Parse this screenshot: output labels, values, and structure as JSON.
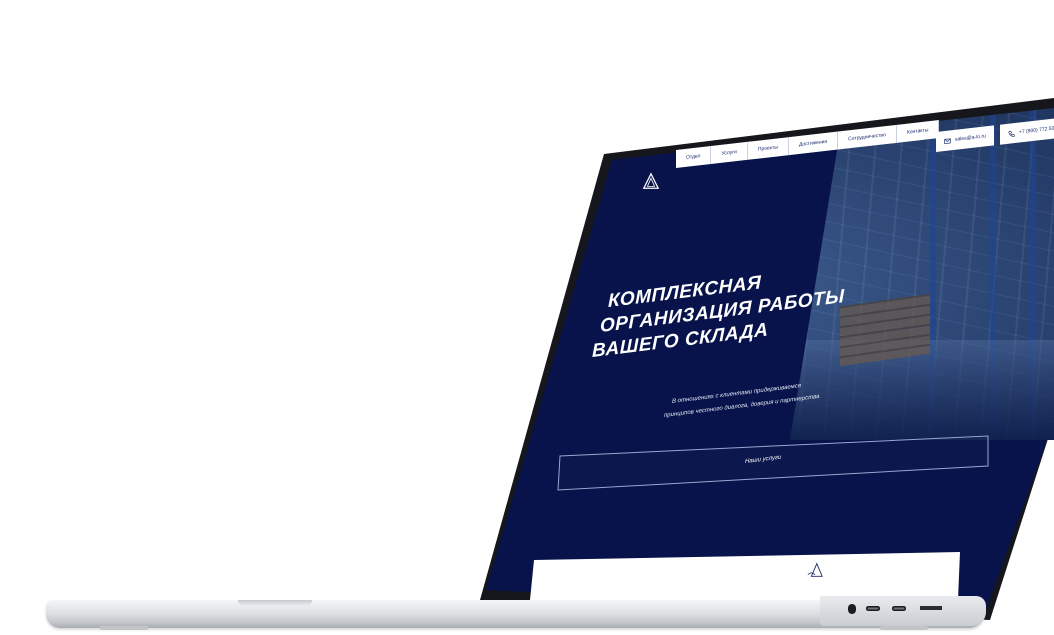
{
  "nav": {
    "items": [
      "Отдел",
      "Услуги",
      "Проекты",
      "Достижения",
      "Сотрудничество",
      "Контакты"
    ]
  },
  "contacts": {
    "email": "sales@a-lo.ru",
    "phone": "+7 (900) 772 50 …"
  },
  "hero": {
    "title_line1": "КОМПЛЕКСНАЯ",
    "title_line2": "ОРГАНИЗАЦИЯ РАБОТЫ",
    "title_line3": "ВАШЕГО СКЛАДА",
    "subtitle_line1": "В отношениях с клиентами придерживаемся",
    "subtitle_line2": "принципов честного диалога, доверия и партнерства",
    "cta_label": "Наши услуги"
  },
  "icons": {
    "logo": "triangle-logo-icon",
    "email": "mail-icon",
    "phone": "phone-icon"
  },
  "colors": {
    "hero_bg": "#07134a",
    "nav_bg": "#ffffff",
    "text_on_dark": "#ffffff"
  }
}
